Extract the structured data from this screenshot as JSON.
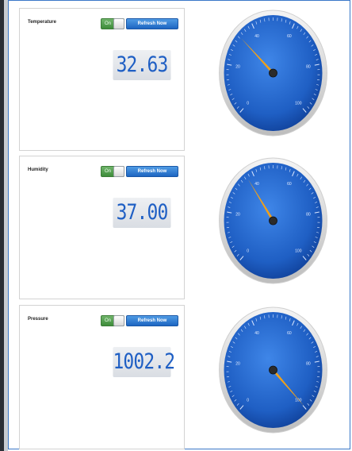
{
  "sensors": [
    {
      "label": "Temperature",
      "toggle": "On",
      "refresh": "Refresh Now",
      "display": "32.63",
      "value": 32.63
    },
    {
      "label": "Humidity",
      "toggle": "On",
      "refresh": "Refresh Now",
      "display": "37.00",
      "value": 37.0
    },
    {
      "label": "Pressure",
      "toggle": "On",
      "refresh": "Refresh Now",
      "display": "1002.2",
      "value": 100
    }
  ],
  "gauge": {
    "min": 0,
    "max": 100,
    "tick_labels": [
      "0",
      "20",
      "40",
      "60",
      "80",
      "100"
    ],
    "face_color": "#1f5fc4",
    "needle_color": "#f0a019"
  }
}
